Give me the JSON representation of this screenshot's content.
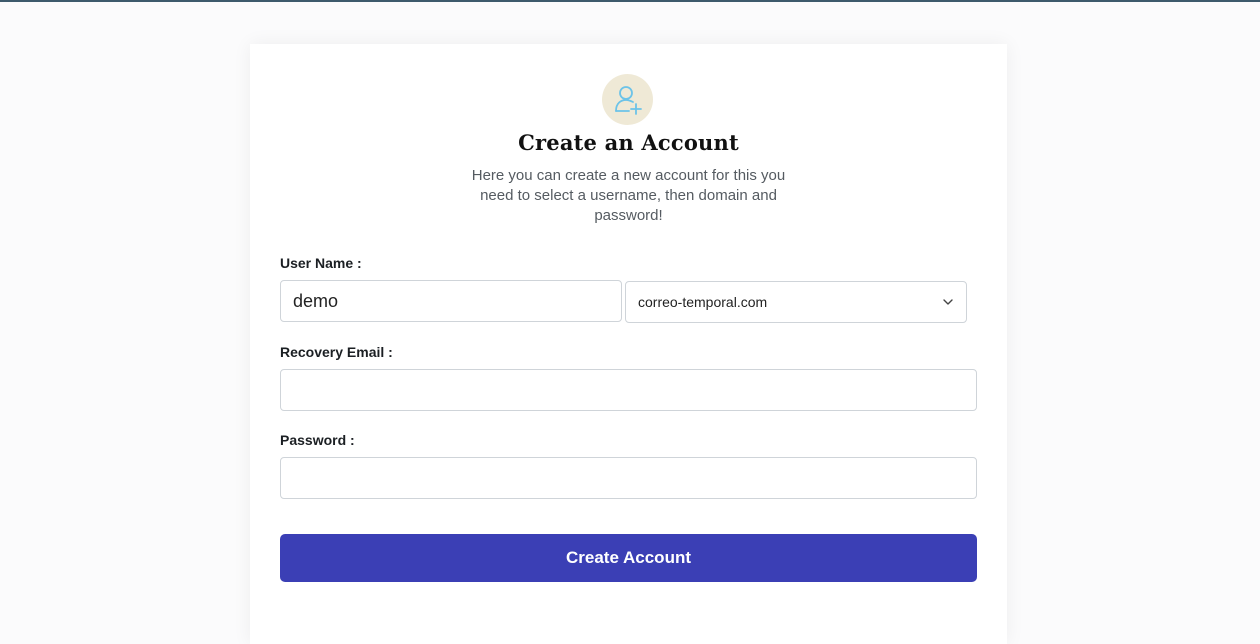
{
  "form": {
    "title": "Create an Account",
    "subtitle": "Here you can create a new account for this you need to select a username, then domain and password!",
    "username_label": "User Name :",
    "username_value": "demo",
    "domain_selected": "correo-temporal.com",
    "recovery_label": "Recovery Email :",
    "recovery_value": "",
    "password_label": "Password :",
    "password_value": "",
    "submit_label": "Create Account"
  },
  "icons": {
    "avatar": "user-plus-icon",
    "select_arrow": "chevron-down-icon"
  },
  "colors": {
    "accent": "#3b3fb5",
    "avatar_bg": "#efe9d6",
    "icon_stroke": "#6cc3e8"
  }
}
